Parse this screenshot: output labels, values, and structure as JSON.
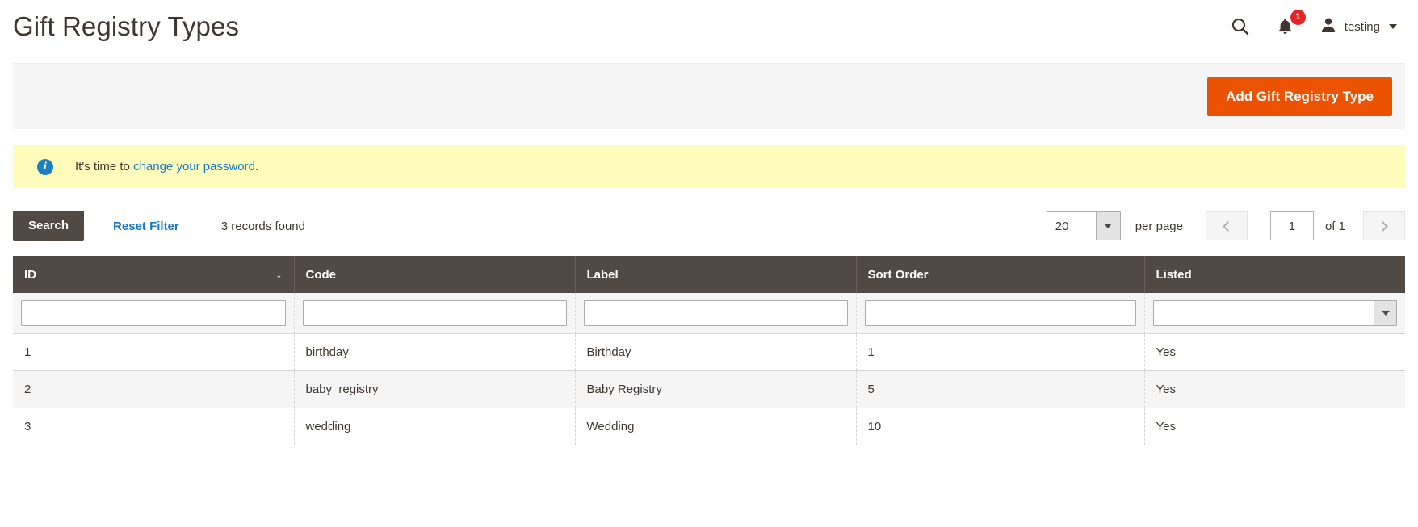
{
  "header": {
    "title": "Gift Registry Types",
    "search_icon": "search-icon",
    "notifications_icon": "bell-icon",
    "notifications_count": "1",
    "avatar_icon": "user-avatar-icon",
    "user_name": "testing"
  },
  "action_bar": {
    "add_button_label": "Add Gift Registry Type",
    "accent_color": "#eb5202"
  },
  "message": {
    "icon": "info-icon",
    "icon_glyph": "i",
    "text_before": "It's time to ",
    "link_text": "change your password",
    "text_after": ".",
    "background_color": "#fffbbb",
    "link_color": "#1979c3"
  },
  "toolbar": {
    "search_label": "Search",
    "reset_filter_label": "Reset Filter",
    "records_found": "3 records found",
    "per_page_value": "20",
    "per_page_label": "per page",
    "prev_icon": "chevron-left-icon",
    "next_icon": "chevron-right-icon",
    "current_page": "1",
    "of_total": "of 1"
  },
  "grid": {
    "columns": [
      {
        "label": "ID",
        "sorted": true,
        "sort_arrow": "↓"
      },
      {
        "label": "Code",
        "sorted": false,
        "sort_arrow": ""
      },
      {
        "label": "Label",
        "sorted": false,
        "sort_arrow": ""
      },
      {
        "label": "Sort Order",
        "sorted": false,
        "sort_arrow": ""
      },
      {
        "label": "Listed",
        "sorted": false,
        "sort_arrow": ""
      }
    ],
    "filters": {
      "id": "",
      "code": "",
      "label": "",
      "sort_order": "",
      "listed": ""
    },
    "rows": [
      {
        "id": "1",
        "code": "birthday",
        "label": "Birthday",
        "sort_order": "1",
        "listed": "Yes"
      },
      {
        "id": "2",
        "code": "baby_registry",
        "label": "Baby Registry",
        "sort_order": "5",
        "listed": "Yes"
      },
      {
        "id": "3",
        "code": "wedding",
        "label": "Wedding",
        "sort_order": "10",
        "listed": "Yes"
      }
    ]
  }
}
